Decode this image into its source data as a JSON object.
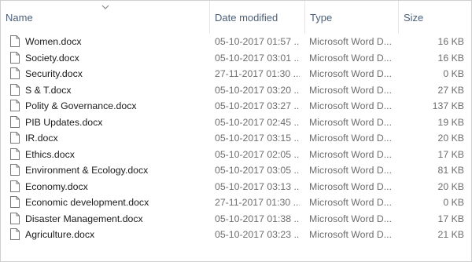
{
  "columns": {
    "name": "Name",
    "date": "Date modified",
    "type": "Type",
    "size": "Size"
  },
  "files": [
    {
      "name": "Women.docx",
      "date": "05-10-2017 01:57 ...",
      "type": "Microsoft Word D...",
      "size": "16 KB"
    },
    {
      "name": "Society.docx",
      "date": "05-10-2017 03:01 ...",
      "type": "Microsoft Word D...",
      "size": "16 KB"
    },
    {
      "name": "Security.docx",
      "date": "27-11-2017 01:30 ...",
      "type": "Microsoft Word D...",
      "size": "0 KB"
    },
    {
      "name": "S & T.docx",
      "date": "05-10-2017 03:20 ...",
      "type": "Microsoft Word D...",
      "size": "27 KB"
    },
    {
      "name": "Polity & Governance.docx",
      "date": "05-10-2017 03:27 ...",
      "type": "Microsoft Word D...",
      "size": "137 KB"
    },
    {
      "name": "PIB Updates.docx",
      "date": "05-10-2017 02:45 ...",
      "type": "Microsoft Word D...",
      "size": "19 KB"
    },
    {
      "name": "IR.docx",
      "date": "05-10-2017 03:15 ...",
      "type": "Microsoft Word D...",
      "size": "20 KB"
    },
    {
      "name": "Ethics.docx",
      "date": "05-10-2017 02:05 ...",
      "type": "Microsoft Word D...",
      "size": "17 KB"
    },
    {
      "name": "Environment & Ecology.docx",
      "date": "05-10-2017 03:05 ...",
      "type": "Microsoft Word D...",
      "size": "81 KB"
    },
    {
      "name": "Economy.docx",
      "date": "05-10-2017 03:13 ...",
      "type": "Microsoft Word D...",
      "size": "20 KB"
    },
    {
      "name": "Economic development.docx",
      "date": "27-11-2017 01:30 ...",
      "type": "Microsoft Word D...",
      "size": "0 KB"
    },
    {
      "name": "Disaster Management.docx",
      "date": "05-10-2017 01:38 ...",
      "type": "Microsoft Word D...",
      "size": "17 KB"
    },
    {
      "name": "Agriculture.docx",
      "date": "05-10-2017 03:23 ...",
      "type": "Microsoft Word D...",
      "size": "21 KB"
    }
  ],
  "colors": {
    "header_text": "#4c607a",
    "name_text": "#1b1b1b",
    "detail_text": "#6d6d6d"
  },
  "icons": {
    "sort": "chevron-down-icon",
    "file": "document-icon"
  }
}
